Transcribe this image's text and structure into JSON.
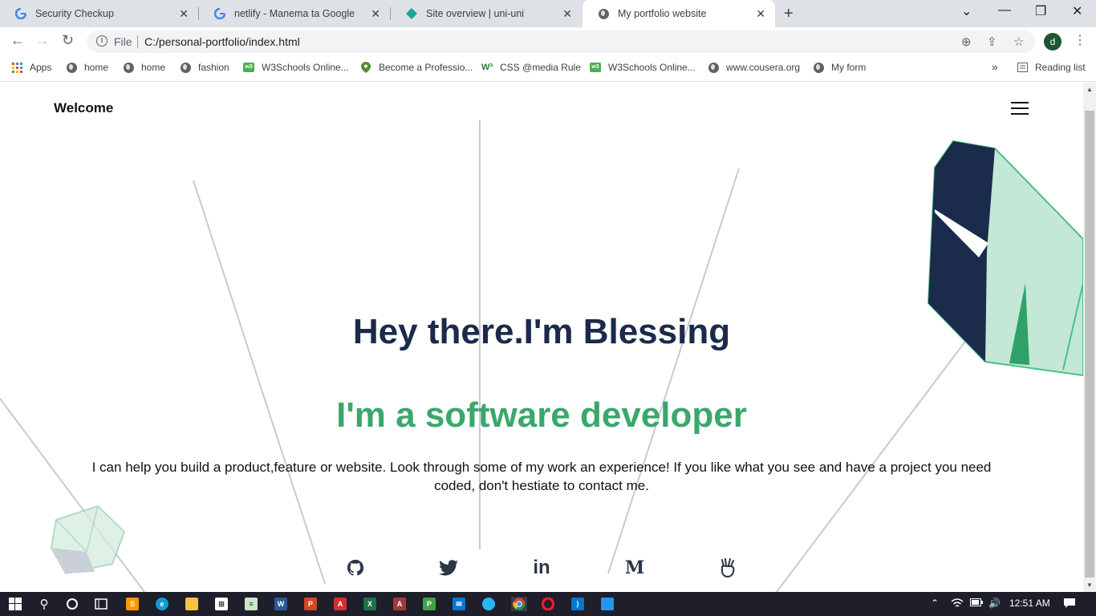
{
  "browser": {
    "tabs": [
      {
        "title": "Security Checkup",
        "icon": "google-icon"
      },
      {
        "title": "netlify - Manema ta Google",
        "icon": "google-icon"
      },
      {
        "title": "Site overview | uni-uni",
        "icon": "netlify-icon"
      },
      {
        "title": "My portfolio website",
        "icon": "globe-icon"
      }
    ],
    "omnibox": {
      "scheme_label": "File",
      "url": "C:/personal-portfolio/index.html"
    },
    "profile_initial": "d",
    "bookmarks": [
      {
        "label": "Apps",
        "icon": "apps-grid-icon"
      },
      {
        "label": "home",
        "icon": "globe-icon"
      },
      {
        "label": "home",
        "icon": "globe-icon"
      },
      {
        "label": "fashion",
        "icon": "globe-icon"
      },
      {
        "label": "W3Schools Online...",
        "icon": "w3schools-icon"
      },
      {
        "label": "Become a Professio...",
        "icon": "location-pin-icon"
      },
      {
        "label": "CSS @media Rule",
        "icon": "w3-icon"
      },
      {
        "label": "W3Schools Online...",
        "icon": "w3schools-icon"
      },
      {
        "label": "www.cousera.org",
        "icon": "globe-icon"
      },
      {
        "label": "My form",
        "icon": "globe-icon"
      }
    ],
    "overflow_label": "»",
    "reading_list_label": "Reading list"
  },
  "page": {
    "brand": "Welcome",
    "hero_title": "Hey there.I'm Blessing",
    "hero_subtitle": "I'm a software developer",
    "hero_text": "I can help you build a product,feature or website. Look through some of my work an experience! If you like what you see and have a project you need coded, don't hestiate to contact me.",
    "social_icons": [
      "github-icon",
      "twitter-icon",
      "linkedin-icon",
      "medium-icon",
      "angellist-icon"
    ],
    "colors": {
      "title": "#1b2a4a",
      "subtitle": "#3aa76d"
    }
  },
  "taskbar": {
    "clock": "12:51 AM"
  }
}
